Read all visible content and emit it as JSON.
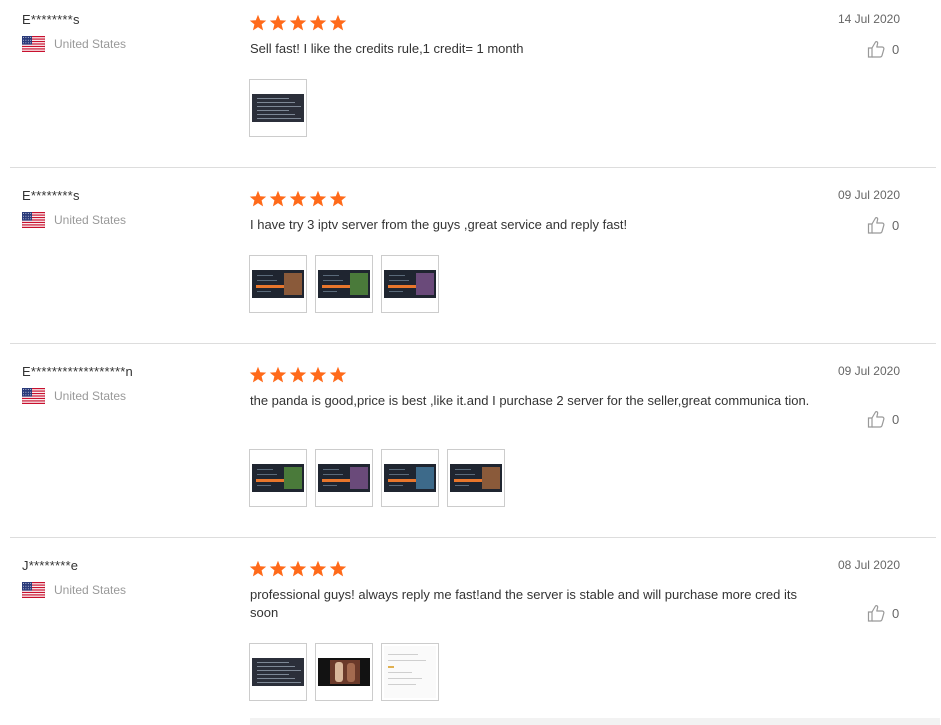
{
  "colors": {
    "star": "#ff6a1a",
    "separator": "#dddddd",
    "text": "#333333",
    "muted": "#999999"
  },
  "reviews": [
    {
      "user": "E********s",
      "country": "United States",
      "flag": "us-flag-icon",
      "stars": 5,
      "text": "Sell fast! I like the credits rule,1 credit= 1 month",
      "date": "14 Jul 2020",
      "helpful": "0",
      "photos": [
        "table"
      ]
    },
    {
      "user": "E********s",
      "country": "United States",
      "flag": "us-flag-icon",
      "stars": 5,
      "text": "I have try 3 iptv server from the guys ,great service and reply fast!",
      "date": "09 Jul 2020",
      "helpful": "0",
      "photos": [
        "tv",
        "tv",
        "tv"
      ]
    },
    {
      "user": "E******************n",
      "country": "United States",
      "flag": "us-flag-icon",
      "stars": 5,
      "text": "the panda is good,price is best ,like it.and I purchase 2 server for the seller,great communica tion.",
      "date": "09 Jul 2020",
      "helpful": "0",
      "photos": [
        "tv",
        "tv",
        "tv",
        "tv"
      ]
    },
    {
      "user": "J********e",
      "country": "United States",
      "flag": "us-flag-icon",
      "stars": 5,
      "text": "professional guys! always reply me fast!and the server is stable and will purchase more cred its soon",
      "date": "08 Jul 2020",
      "helpful": "0",
      "photos": [
        "table",
        "video",
        "document"
      ]
    }
  ]
}
